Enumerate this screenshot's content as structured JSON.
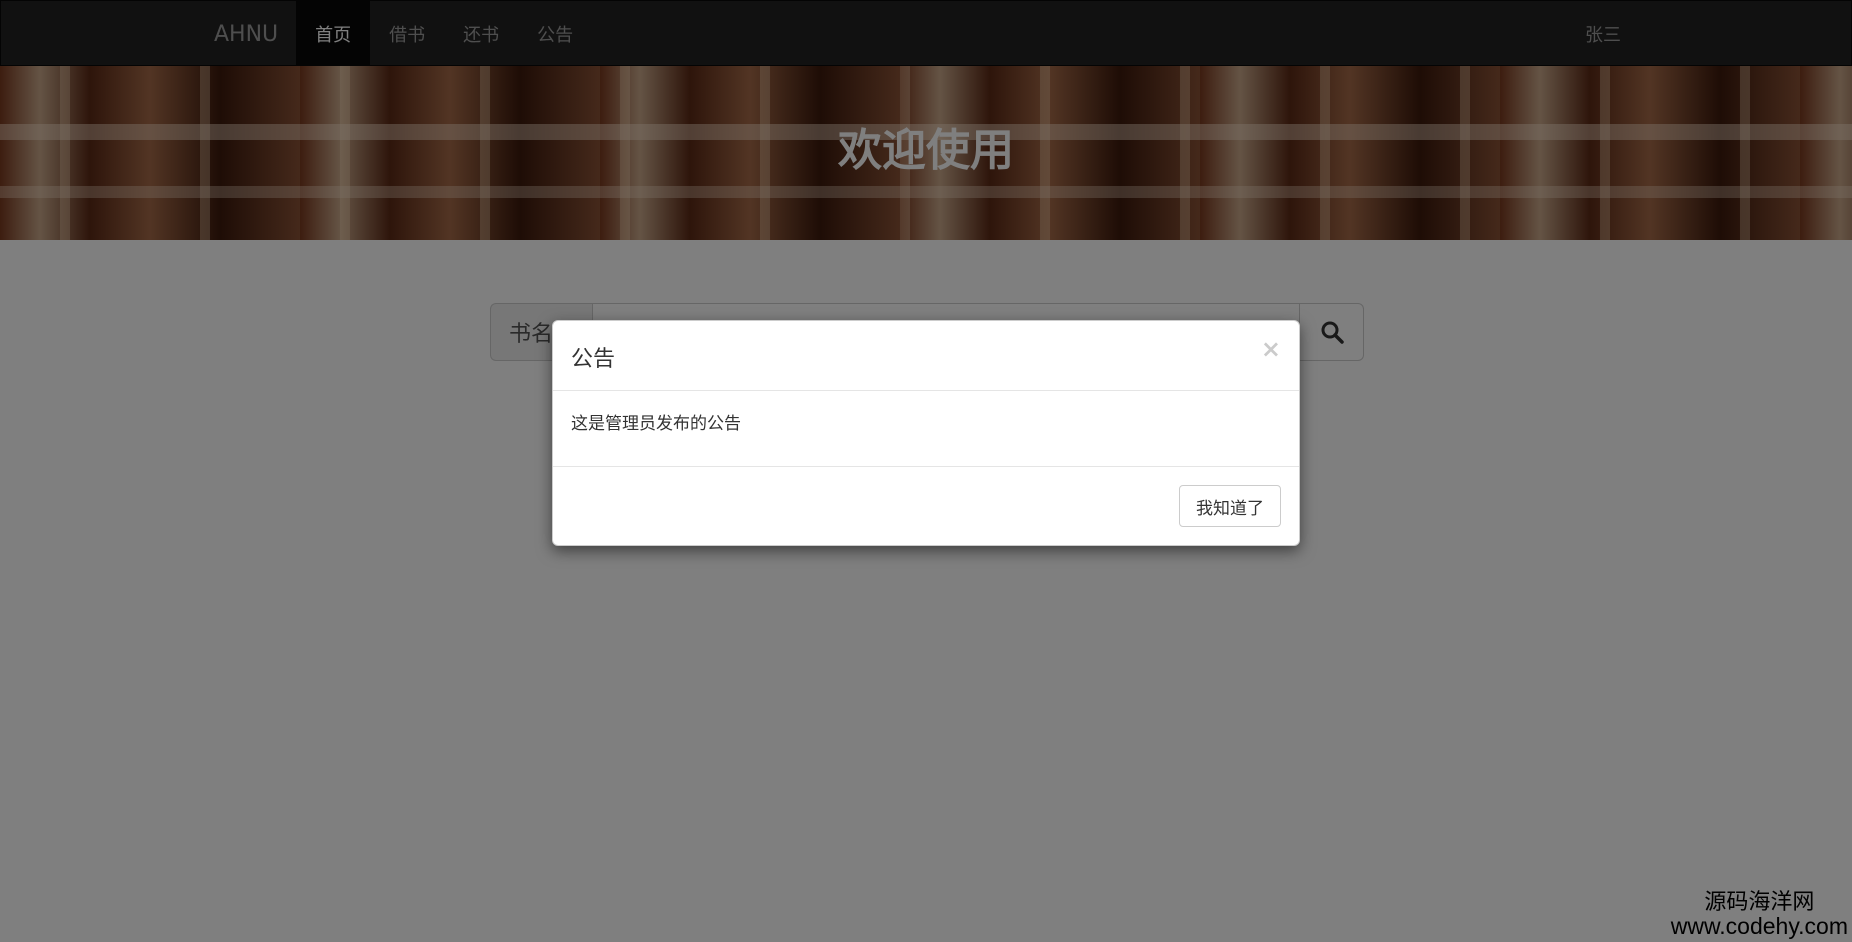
{
  "navbar": {
    "brand": "AHNU",
    "items": [
      {
        "label": "首页",
        "active": true
      },
      {
        "label": "借书",
        "active": false
      },
      {
        "label": "还书",
        "active": false
      },
      {
        "label": "公告",
        "active": false
      }
    ],
    "user": "张三"
  },
  "hero": {
    "title": "欢迎使用"
  },
  "search": {
    "label": "书名",
    "value": "",
    "button_icon": "search-icon"
  },
  "modal": {
    "title": "公告",
    "close_symbol": "×",
    "body": "这是管理员发布的公告",
    "ok_label": "我知道了"
  },
  "watermark": {
    "name": "源码海洋网",
    "url": "www.codehy.com"
  },
  "colors": {
    "navbar_bg": "#222222",
    "nav_active_bg": "#080808",
    "nav_text": "#9d9d9d",
    "backdrop": "rgba(0,0,0,0.5)"
  }
}
